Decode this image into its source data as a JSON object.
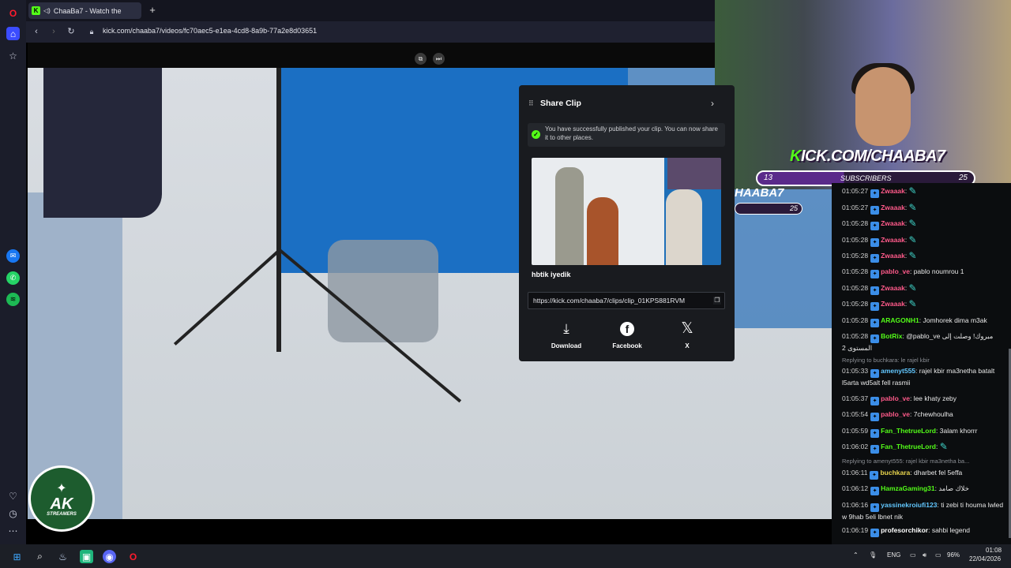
{
  "browser": {
    "tab_title": "ChaaBa7 - Watch the",
    "tab_favicon": "K",
    "url": "kick.com/chaaba7/videos/fc70aec5-e1ea-4cd8-8a9b-77a2e8d03651"
  },
  "share_modal": {
    "title": "Share Clip",
    "notice": "You have successfully published your clip. You can now share it to other places.",
    "clip_title": "hbtik iyedik",
    "clip_url": "https://kick.com/chaaba7/clips/clip_01KPS881RVM",
    "options": [
      {
        "label": "Download",
        "icon": "download-icon"
      },
      {
        "label": "Facebook",
        "icon": "facebook-icon"
      },
      {
        "label": "X",
        "icon": "x-logo-icon"
      }
    ]
  },
  "stream_overlay": {
    "brand": "KICK.COM/CHAABA7",
    "brand_k": "K",
    "brand_rest": "ICK.COM/CHAABA7",
    "sub_left": "13",
    "sub_label": "SUBSCRIBERS",
    "sub_right": "25",
    "ghost_brand": "HAABA7",
    "ghost_count": "25",
    "badge_main": "AK",
    "badge_sub": "STREAMERS"
  },
  "chat": {
    "accent": "#53fc18",
    "messages": [
      {
        "time": "01:05:27",
        "user": "Zwaaak",
        "color": "#ff5a8a",
        "text": ""
      },
      {
        "time": "01:05:27",
        "user": "Zwaaak",
        "color": "#ff5a8a",
        "text": ""
      },
      {
        "time": "01:05:28",
        "user": "Zwaaak",
        "color": "#ff5a8a",
        "text": ""
      },
      {
        "time": "01:05:28",
        "user": "Zwaaak",
        "color": "#ff5a8a",
        "text": ""
      },
      {
        "time": "01:05:28",
        "user": "Zwaaak",
        "color": "#ff5a8a",
        "text": ""
      },
      {
        "time": "01:05:28",
        "user": "pablo_ve",
        "color": "#ff5a8a",
        "text": "pablo noumrou 1"
      },
      {
        "time": "01:05:28",
        "user": "Zwaaak",
        "color": "#ff5a8a",
        "text": ""
      },
      {
        "time": "01:05:28",
        "user": "Zwaaak",
        "color": "#ff5a8a",
        "text": ""
      },
      {
        "time": "01:05:28",
        "user": "ARAGONH1",
        "color": "#53fc18",
        "text": "Jomhorek dima m3ak"
      },
      {
        "time": "01:05:28",
        "user": "BotRix",
        "color": "#53fc18",
        "text": "@pablo_ve مبروك! وصلت إلى المستوى 2"
      },
      {
        "reply": "Replying to buchkara: le rajel kbir"
      },
      {
        "time": "01:05:33",
        "user": "amenyt555",
        "color": "#62c7ff",
        "text": "rajel kbir ma3netha batalt l5arta wd5alt fell rasmii"
      },
      {
        "time": "01:05:37",
        "user": "pablo_ve",
        "color": "#ff5a8a",
        "text": "lee khaty zeby"
      },
      {
        "time": "01:05:54",
        "user": "pablo_ve",
        "color": "#ff5a8a",
        "text": "7chewhoulha"
      },
      {
        "time": "01:05:59",
        "user": "Fan_ThetrueLord",
        "color": "#53fc18",
        "text": "3alam khorrr"
      },
      {
        "time": "01:06:02",
        "user": "Fan_ThetrueLord",
        "color": "#53fc18",
        "text": ""
      },
      {
        "reply": "Replying to amenyt555: rajel kbir ma3netha ba..."
      },
      {
        "time": "01:06:11",
        "user": "buchkara",
        "color": "#e8d44d",
        "text": "dharbet fel 5effa"
      },
      {
        "time": "01:06:12",
        "user": "HamzaGaming31",
        "color": "#53fc18",
        "text": "خلاك صامد"
      },
      {
        "time": "01:06:16",
        "user": "yassinekroiufi123",
        "color": "#62c7ff",
        "text": "ti zebi ti houma lwled w 9hab 5eli lbnet nik"
      },
      {
        "time": "01:06:19",
        "user": "profesorchikor",
        "color": "#ffffff",
        "text": "sahbi legend"
      }
    ]
  },
  "taskbar": {
    "lang": "ENG",
    "battery": "96%",
    "time": "01:08",
    "date": "22/04/2026"
  }
}
